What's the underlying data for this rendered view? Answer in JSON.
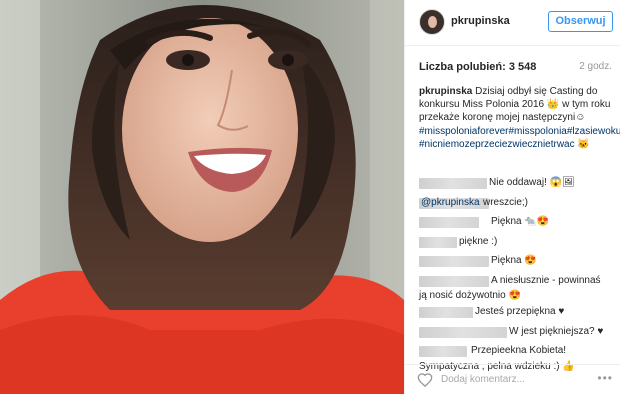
{
  "post": {
    "username": "pkrupinska",
    "follow_label": "Obserwuj",
    "likes": "Liczba polubień: 3 548",
    "time_ago": "2 godz.",
    "caption_user": "pkrupinska",
    "caption_text": " Dzisiaj odbył się Casting do konkursu Miss Polonia 2016 👑 w tym roku przekaże koronę mojej następczyni☺",
    "hashtags": "#misspoloniaforever#misspolonia#lzasiewokukreci #nicniemozeprzeciezwiecznietrwac 🐱"
  },
  "comments": [
    {
      "text": "Nie oddawaj! 😱🖼"
    },
    {
      "mention": "@pkrupinska",
      "text": " wreszcie;)"
    },
    {
      "text": "Piękna 🐀😍"
    },
    {
      "text": "piękne :)"
    },
    {
      "text": "Piękna 😍"
    },
    {
      "text": "A niesłusznie - powinnaś"
    },
    {
      "text": "ją nosić dożywotnio 😍"
    },
    {
      "text": "Jesteś przepiękna ♥"
    },
    {
      "text": "W jest piękniejsza? ♥"
    },
    {
      "text": "Przepieekna Kobieta!"
    },
    {
      "text": "Sympatyczna , pelna wdzieku :) 👍"
    }
  ],
  "footer": {
    "add_comment_placeholder": "Dodaj komentarz...",
    "more_label": "•••"
  },
  "icons": {
    "heart": "heart-outline-icon",
    "more": "more-options-icon"
  },
  "colors": {
    "link_blue": "#3897f0",
    "hashtag_blue": "#003569",
    "shirt_red": "#e8402c"
  }
}
